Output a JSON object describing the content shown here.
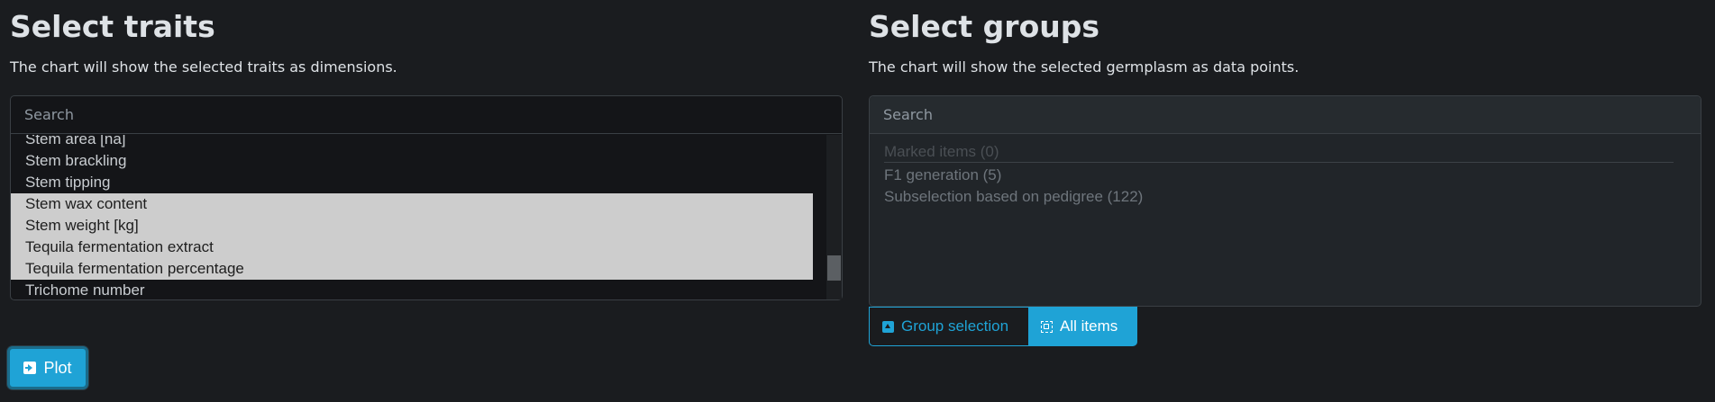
{
  "traits": {
    "title": "Select traits",
    "description": "The chart will show the selected traits as dimensions.",
    "search_placeholder": "Search",
    "items": [
      {
        "label": "Stem area [na]",
        "selected": false
      },
      {
        "label": "Stem brackling",
        "selected": false
      },
      {
        "label": "Stem tipping",
        "selected": false
      },
      {
        "label": "Stem wax content",
        "selected": true
      },
      {
        "label": "Stem weight [kg]",
        "selected": true
      },
      {
        "label": "Tequila fermentation extract",
        "selected": true
      },
      {
        "label": "Tequila fermentation percentage",
        "selected": true
      },
      {
        "label": "Trichome number",
        "selected": false
      }
    ]
  },
  "groups": {
    "title": "Select groups",
    "description": "The chart will show the selected germplasm as data points.",
    "search_placeholder": "Search",
    "items": [
      {
        "label": "Marked items (0)",
        "disabled": true
      },
      {
        "label": "F1 generation (5)",
        "disabled": false
      },
      {
        "label": "Subselection based on pedigree (122)",
        "disabled": false
      }
    ],
    "toggle": {
      "group_selection_label": "Group selection",
      "all_items_label": "All items",
      "active": "All items"
    }
  },
  "plot_button_label": "Plot",
  "colors": {
    "accent": "#1fa3d6",
    "background": "#1a1c1f",
    "selected_item": "#cdcdcd"
  },
  "icons": {
    "group_selection": "arrow-up-square-icon",
    "all_items": "select-all-icon",
    "plot": "box-arrow-right-icon"
  }
}
